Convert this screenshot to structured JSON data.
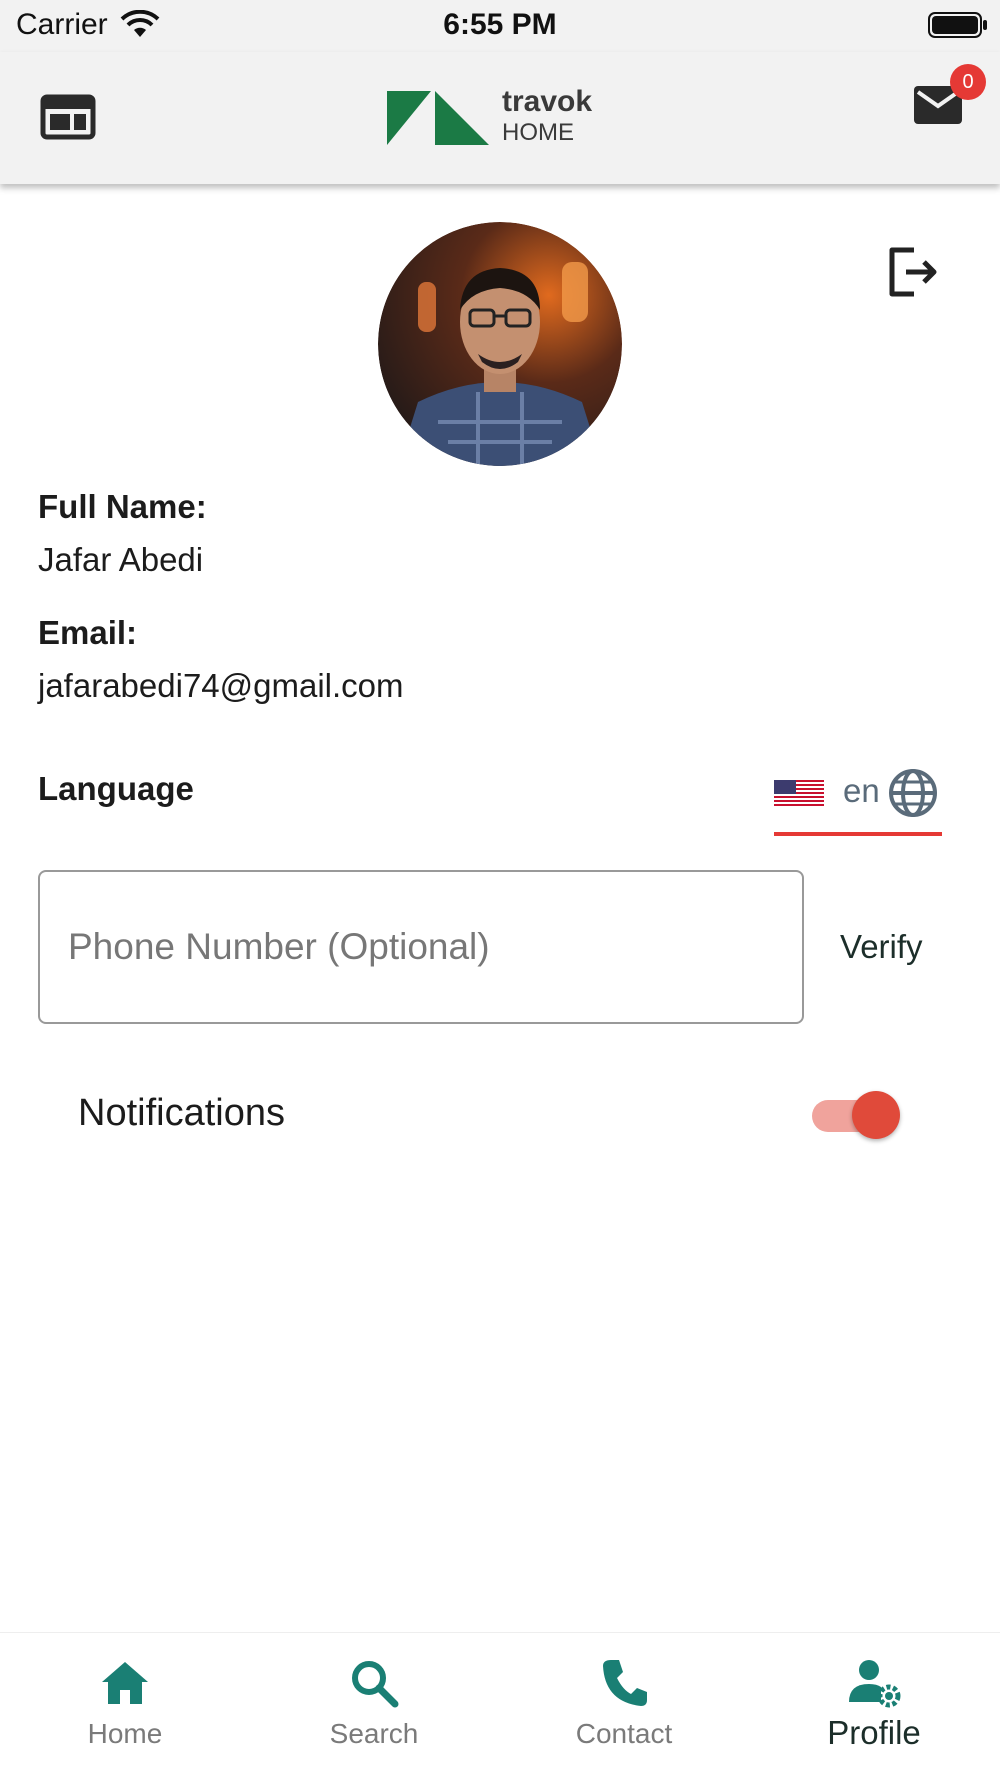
{
  "status_bar": {
    "carrier": "Carrier",
    "time": "6:55 PM"
  },
  "header": {
    "logo_brand": "travok",
    "logo_sub": "HOME",
    "mail_badge": "0"
  },
  "profile": {
    "full_name_label": "Full Name:",
    "full_name": "Jafar Abedi",
    "email_label": "Email:",
    "email": "jafarabedi74@gmail.com",
    "language_label": "Language",
    "language_code": "en",
    "phone_placeholder": "Phone Number (Optional)",
    "phone_value": "",
    "verify_label": "Verify",
    "notifications_label": "Notifications",
    "notifications_on": true
  },
  "bottom_nav": {
    "items": [
      {
        "label": "Home",
        "icon": "home-icon"
      },
      {
        "label": "Search",
        "icon": "search-icon"
      },
      {
        "label": "Contact",
        "icon": "phone-icon"
      },
      {
        "label": "Profile",
        "icon": "profile-settings-icon",
        "active": true
      }
    ]
  },
  "colors": {
    "accent_teal": "#1a7f74",
    "logo_green": "#1b7a45",
    "alert_red": "#e53935",
    "toggle_track": "#f0a39c",
    "toggle_knob": "#e04a3a"
  }
}
